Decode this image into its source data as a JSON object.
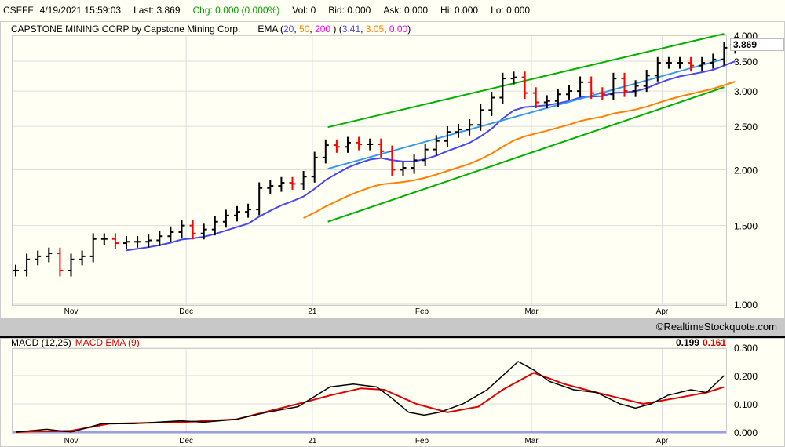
{
  "header": {
    "symbol": "CSFFF",
    "datetime": "4/19/2021 15:59:03",
    "last": "Last: 3.869",
    "chg": "Chg: 0.000 (0.000%)",
    "vol": "Vol: 0",
    "bid": "Bid: 0.000",
    "ask": "Ask: 0.000",
    "hi": "Hi: 0.000",
    "lo": "Lo: 0.000"
  },
  "legend": {
    "title": "CAPSTONE MINING CORP by Capstone Mining Corp.",
    "ema_label": "EMA (",
    "ema_periods": [
      "20",
      "50",
      "200"
    ],
    "ema_values": [
      "3.41",
      "3.05",
      "0.00"
    ]
  },
  "copyright": "©RealtimeStockquote.com",
  "macd_legend": {
    "macd": "MACD (12,25)",
    "signal": "MACD EMA (9)",
    "macd_value": "0.199",
    "signal_value": "0.161"
  },
  "colors": {
    "up": "#000000",
    "down": "#ff0000",
    "ema20": "#4848f0",
    "ema50": "#ff8000",
    "ema200": "#ff00ff",
    "trend": "#00b000",
    "regression": "#3399ee",
    "macd": "#000000",
    "signal": "#dd0000"
  },
  "chart_data": [
    {
      "type": "ohlc",
      "scale": "log",
      "ylim": [
        1.0,
        4.0
      ],
      "yticks": [
        "1.000",
        "1.500",
        "2.000",
        "2.500",
        "3.000",
        "3.500",
        "4.000"
      ],
      "last_price": "3.869",
      "xticks": [
        {
          "label": "Nov",
          "i": 5.0
        },
        {
          "label": "Dec",
          "i": 15.4
        },
        {
          "label": "21",
          "i": 26.8
        },
        {
          "label": "Feb",
          "i": 36.7
        },
        {
          "label": "Mar",
          "i": 46.6
        },
        {
          "label": "Apr",
          "i": 58.4
        }
      ],
      "closes": [
        1.19,
        1.26,
        1.28,
        1.3,
        1.19,
        1.26,
        1.28,
        1.4,
        1.4,
        1.37,
        1.38,
        1.38,
        1.39,
        1.42,
        1.45,
        1.5,
        1.44,
        1.47,
        1.53,
        1.58,
        1.61,
        1.63,
        1.82,
        1.84,
        1.87,
        1.86,
        1.93,
        2.13,
        2.27,
        2.25,
        2.3,
        2.28,
        2.28,
        2.2,
        2.0,
        2.02,
        2.1,
        2.22,
        2.32,
        2.43,
        2.46,
        2.52,
        2.72,
        2.9,
        3.2,
        3.22,
        2.97,
        2.83,
        2.85,
        2.95,
        3.0,
        3.14,
        2.97,
        2.95,
        3.2,
        3.0,
        3.08,
        3.25,
        3.47,
        3.47,
        3.47,
        3.42,
        3.47,
        3.53,
        3.75,
        3.85
      ],
      "trendlines": [
        {
          "name": "upper-channel",
          "from": [
            28.2,
            2.49
          ],
          "to": [
            64,
            4.03
          ]
        },
        {
          "name": "lower-channel",
          "from": [
            28.2,
            1.53
          ],
          "to": [
            64,
            3.06
          ]
        },
        {
          "name": "regression",
          "from": [
            28.2,
            2.01
          ],
          "to": [
            64,
            3.54
          ]
        }
      ]
    },
    {
      "type": "line",
      "ylim": [
        0,
        0.3
      ],
      "yticks": [
        "0.000",
        "0.100",
        "0.200",
        "0.300"
      ],
      "macd": [
        [
          0,
          0
        ],
        [
          2.8,
          0.01
        ],
        [
          5,
          0
        ],
        [
          7.8,
          0.03
        ],
        [
          10.6,
          0.03
        ],
        [
          14.9,
          0.04
        ],
        [
          17,
          0.035
        ],
        [
          19.9,
          0.045
        ],
        [
          22.7,
          0.07
        ],
        [
          25.5,
          0.09
        ],
        [
          28.4,
          0.16
        ],
        [
          30.5,
          0.17
        ],
        [
          32.6,
          0.16
        ],
        [
          34,
          0.12
        ],
        [
          35.5,
          0.07
        ],
        [
          36.9,
          0.06
        ],
        [
          38.3,
          0.07
        ],
        [
          40.4,
          0.1
        ],
        [
          42.6,
          0.15
        ],
        [
          44,
          0.2
        ],
        [
          45.4,
          0.25
        ],
        [
          46.8,
          0.22
        ],
        [
          48.2,
          0.18
        ],
        [
          50.4,
          0.15
        ],
        [
          52.5,
          0.14
        ],
        [
          54.6,
          0.1
        ],
        [
          56,
          0.085
        ],
        [
          57.4,
          0.1
        ],
        [
          58.9,
          0.13
        ],
        [
          61,
          0.15
        ],
        [
          62.4,
          0.14
        ],
        [
          64,
          0.2
        ]
      ],
      "signal": [
        [
          0,
          0
        ],
        [
          5,
          0.005
        ],
        [
          8.5,
          0.03
        ],
        [
          14.9,
          0.035
        ],
        [
          19.9,
          0.045
        ],
        [
          25.5,
          0.1
        ],
        [
          28.4,
          0.13
        ],
        [
          31.2,
          0.155
        ],
        [
          33.3,
          0.15
        ],
        [
          36.2,
          0.1
        ],
        [
          39,
          0.07
        ],
        [
          41.8,
          0.09
        ],
        [
          44,
          0.15
        ],
        [
          46.8,
          0.21
        ],
        [
          49.6,
          0.17
        ],
        [
          52.5,
          0.14
        ],
        [
          54.6,
          0.12
        ],
        [
          56.7,
          0.1
        ],
        [
          59.6,
          0.12
        ],
        [
          62.4,
          0.14
        ],
        [
          64,
          0.16
        ]
      ]
    }
  ]
}
